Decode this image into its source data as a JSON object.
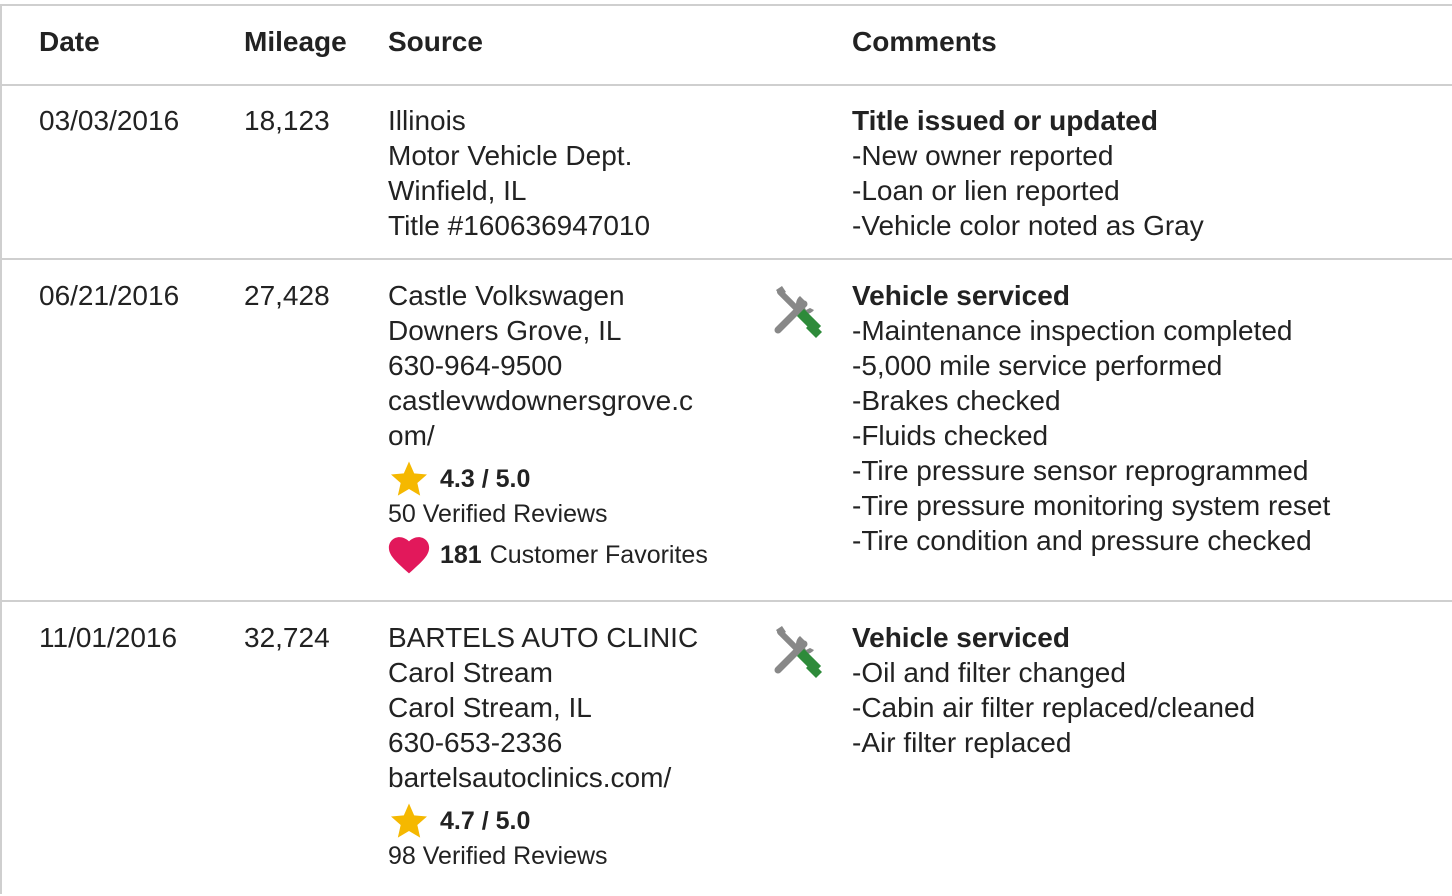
{
  "header": {
    "date": "Date",
    "mileage": "Mileage",
    "source": "Source",
    "comments": "Comments"
  },
  "colors": {
    "border": "#cfcfcf",
    "star": "#f5b800",
    "heart": "#e2185b",
    "wrench_gray": "#888888",
    "screwdriver_green": "#2e8b3a"
  },
  "rows": [
    {
      "date": "03/03/2016",
      "mileage": "18,123",
      "source": [
        "Illinois",
        "Motor Vehicle Dept.",
        "Winfield, IL",
        "Title #160636947010"
      ],
      "icon": null,
      "comment_title": "Title issued or updated",
      "comments": [
        "New owner reported",
        "Loan or lien reported",
        "Vehicle color noted as Gray"
      ]
    },
    {
      "date": "06/21/2016",
      "mileage": "27,428",
      "source": [
        "Castle Volkswagen",
        "Downers Grove, IL",
        "630-964-9500",
        "castlevwdownersgrove.c",
        "om/"
      ],
      "rating": "4.3 / 5.0",
      "reviews": "50 Verified Reviews",
      "favorites_count": "181",
      "favorites_label": "Customer Favorites",
      "icon": "wrench-screwdriver-icon",
      "comment_title": "Vehicle serviced",
      "comments": [
        "Maintenance inspection completed",
        "5,000 mile service performed",
        "Brakes checked",
        "Fluids checked",
        "Tire pressure sensor reprogrammed",
        "Tire pressure monitoring system reset",
        "Tire condition and pressure checked"
      ]
    },
    {
      "date": "11/01/2016",
      "mileage": "32,724",
      "source": [
        "BARTELS AUTO CLINIC",
        "Carol Stream",
        "Carol Stream, IL",
        "630-653-2336",
        "bartelsautoclinics.com/"
      ],
      "rating": "4.7 / 5.0",
      "reviews": "98 Verified Reviews",
      "icon": "wrench-screwdriver-icon",
      "comment_title": "Vehicle serviced",
      "comments": [
        "Oil and filter changed",
        "Cabin air filter replaced/cleaned",
        "Air filter replaced"
      ]
    }
  ],
  "bullet": "-"
}
